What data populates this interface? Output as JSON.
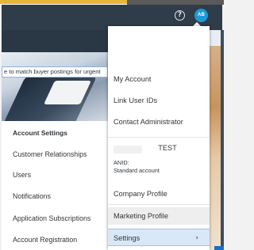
{
  "header": {
    "help_icon": "help-circle-icon",
    "help_glyph": "?",
    "avatar_initials": "AB",
    "avatar_color": "#1d9ad6",
    "shell_color": "#2f3c49"
  },
  "banner": {
    "text": "e to match buyer postings for urgent"
  },
  "account_settings": {
    "heading": "Account Settings",
    "items": [
      "Customer Relationships",
      "Users",
      "Notifications",
      "Application Subscriptions",
      "Account Registration"
    ]
  },
  "user_menu": {
    "top_items": [
      "My Account",
      "Link User IDs",
      "Contact Administrator"
    ],
    "account": {
      "name": "TEST",
      "anid_label": "ANID:",
      "type": "Standard account"
    },
    "bottom_items": [
      "Company Profile",
      "Marketing Profile"
    ],
    "settings_label": "Settings",
    "settings_chevron": "›",
    "selected_color": "#d9e8f8"
  }
}
